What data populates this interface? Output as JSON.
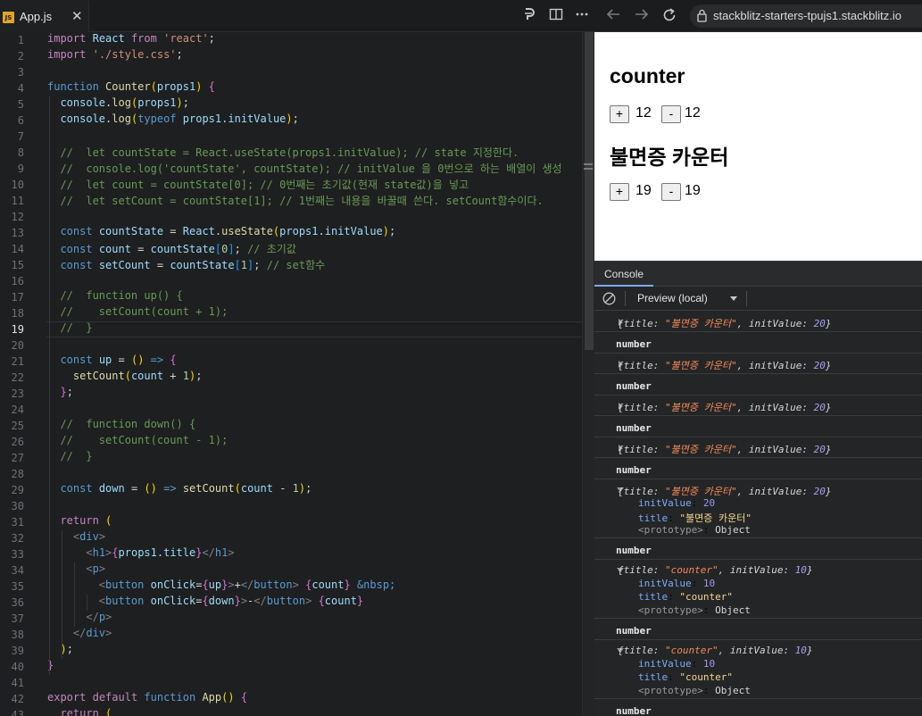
{
  "tab": {
    "icon": "JS",
    "label": "App.js",
    "close": "✕"
  },
  "browser": {
    "url": "stackblitz-starters-tpujs1.stackblitz.io"
  },
  "editor": {
    "active_line": 19,
    "line_numbers": [
      "1",
      "2",
      "3",
      "4",
      "5",
      "6",
      "7",
      "8",
      "9",
      "10",
      "11",
      "12",
      "13",
      "14",
      "15",
      "16",
      "17",
      "18",
      "19",
      "20",
      "21",
      "22",
      "23",
      "24",
      "25",
      "26",
      "27",
      "28",
      "29",
      "30",
      "31",
      "32",
      "33",
      "34",
      "35",
      "36",
      "37",
      "38",
      "39",
      "40",
      "41",
      "42",
      "43"
    ],
    "lines": [
      "import React from 'react';",
      "import './style.css';",
      "",
      "function Counter(props1) {",
      "  console.log(props1);",
      "  console.log(typeof props1.initValue);",
      "",
      "  //  let countState = React.useState(props1.initValue); // state 지정한다.",
      "  //  console.log('countState', countState); // initValue 을 0번으로 하는 배열이 생성",
      "  //  let count = countState[0]; // 0번째는 초기값(현재 state값)을 넣고",
      "  //  let setCount = countState[1]; // 1번째는 내용을 바꿀때 쓴다. setCount함수이다.",
      "",
      "  const countState = React.useState(props1.initValue);",
      "  const count = countState[0]; // 초기값",
      "  const setCount = countState[1]; // set함수",
      "",
      "  //  function up() {",
      "  //    setCount(count + 1);",
      "  //  }",
      "",
      "  const up = () => {",
      "    setCount(count + 1);",
      "  };",
      "",
      "  //  function down() {",
      "  //    setCount(count - 1);",
      "  //  }",
      "",
      "  const down = () => setCount(count - 1);",
      "",
      "  return (",
      "    <div>",
      "      <h1>{props1.title}</h1>",
      "      <p>",
      "        <button onClick={up}>+</button> {count} &nbsp;",
      "        <button onClick={down}>-</button> {count}",
      "      </p>",
      "    </div>",
      "  );",
      "}",
      "",
      "export default function App() {",
      "  return ("
    ]
  },
  "preview": {
    "counters": [
      {
        "title": "counter",
        "plus": "+",
        "minus": "-",
        "count_a": "12",
        "count_b": "12"
      },
      {
        "title": "불면증 카운터",
        "plus": "+",
        "minus": "-",
        "count_a": "19",
        "count_b": "19"
      }
    ]
  },
  "console": {
    "tab_label": "Console",
    "context": "Preview (local)",
    "messages": [
      {
        "kind": "obj",
        "expanded": false,
        "text_open": "{title: ",
        "title_val": "\"불면증 카운터\"",
        "mid": ", initValue: ",
        "init_val": "20",
        "text_close": "}"
      },
      {
        "kind": "num",
        "text": "number"
      },
      {
        "kind": "obj",
        "expanded": false,
        "text_open": "{title: ",
        "title_val": "\"불면증 카운터\"",
        "mid": ", initValue: ",
        "init_val": "20",
        "text_close": "}"
      },
      {
        "kind": "num",
        "text": "number"
      },
      {
        "kind": "obj",
        "expanded": false,
        "text_open": "{title: ",
        "title_val": "\"불면증 카운터\"",
        "mid": ", initValue: ",
        "init_val": "20",
        "text_close": "}"
      },
      {
        "kind": "num",
        "text": "number"
      },
      {
        "kind": "obj",
        "expanded": false,
        "text_open": "{title: ",
        "title_val": "\"불면증 카운터\"",
        "mid": ", initValue: ",
        "init_val": "20",
        "text_close": "}"
      },
      {
        "kind": "num",
        "text": "number"
      },
      {
        "kind": "obj",
        "expanded": true,
        "text_open": "{title: ",
        "title_val": "\"불면증 카운터\"",
        "mid": ", initValue: ",
        "init_val": "20",
        "text_close": "}",
        "props": [
          {
            "k": "initValue",
            "v": "20"
          },
          {
            "k": "title",
            "v": "\"불면증 카운터\""
          }
        ],
        "proto_k": "<prototype>",
        "proto_v": "Object"
      },
      {
        "kind": "num",
        "text": "number"
      },
      {
        "kind": "obj",
        "expanded": true,
        "text_open": "{title: ",
        "title_val": "\"counter\"",
        "mid": ", initValue: ",
        "init_val": "10",
        "text_close": "}",
        "props": [
          {
            "k": "initValue",
            "v": "10"
          },
          {
            "k": "title",
            "v": "\"counter\""
          }
        ],
        "proto_k": "<prototype>",
        "proto_v": "Object"
      },
      {
        "kind": "num",
        "text": "number"
      },
      {
        "kind": "obj",
        "expanded": true,
        "text_open": "{title: ",
        "title_val": "\"counter\"",
        "mid": ", initValue: ",
        "init_val": "10",
        "text_close": "}",
        "props": [
          {
            "k": "initValue",
            "v": "10"
          },
          {
            "k": "title",
            "v": "\"counter\""
          }
        ],
        "proto_k": "<prototype>",
        "proto_v": "Object"
      },
      {
        "kind": "num",
        "text": "number"
      }
    ]
  }
}
